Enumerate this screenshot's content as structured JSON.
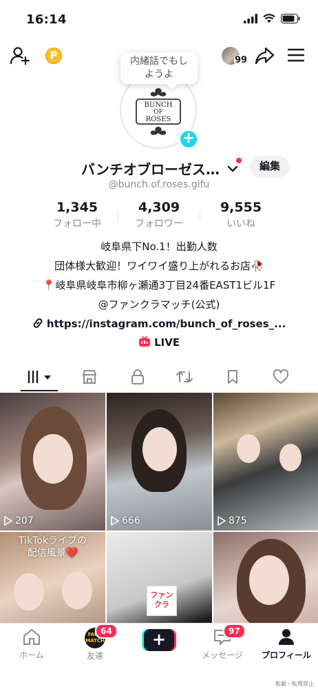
{
  "status_bar": {
    "time": "16:14"
  },
  "header": {
    "coin_label": "P",
    "visitor_count": "99"
  },
  "tooltip": {
    "line1": "内緒話でもし",
    "line2": "ようよ"
  },
  "logo": {
    "text1": "BUNCH",
    "text2": "OF",
    "text3": "ROSES"
  },
  "profile": {
    "name": "バンチオブローゼス…",
    "handle": "@bunch.of.roses.gifu",
    "edit_label": "編集"
  },
  "stats": [
    {
      "num": "1,345",
      "label": "フォロー中"
    },
    {
      "num": "4,309",
      "label": "フォロワー"
    },
    {
      "num": "9,555",
      "label": "いいね"
    }
  ],
  "bio": {
    "line1": "岐阜県下No.1！出勤人数",
    "line2": "団体様大歓迎！ワイワイ盛り上がれるお店🥀",
    "line3": "📍岐阜県岐阜市柳ヶ瀬通3丁目24番EAST1ビル1F",
    "line4": "@ファンクラマッチ(公式)",
    "link": "https://instagram.com/bunch_of_roses_..."
  },
  "live_label": "LIVE",
  "videos": [
    {
      "views": "207"
    },
    {
      "views": "666"
    },
    {
      "views": "875"
    },
    {
      "overlay_line1": "TikTokライブの",
      "overlay_line2": "配信風景❤️"
    },
    {
      "sticker_line1": "ファン",
      "sticker_line2": "クラ"
    },
    {}
  ],
  "tabbar": {
    "home": "ホーム",
    "friends": "友達",
    "friends_badge": "64",
    "create": "+",
    "inbox": "メッセージ",
    "inbox_badge": "97",
    "profile": "プロフィール"
  },
  "friends_avatar_text": "FANK MATCH",
  "footnote": "転載・転用禁止",
  "colors": {
    "accent_red": "#fe2c55",
    "accent_cyan": "#20d5ec",
    "coin": "#f5c237"
  }
}
